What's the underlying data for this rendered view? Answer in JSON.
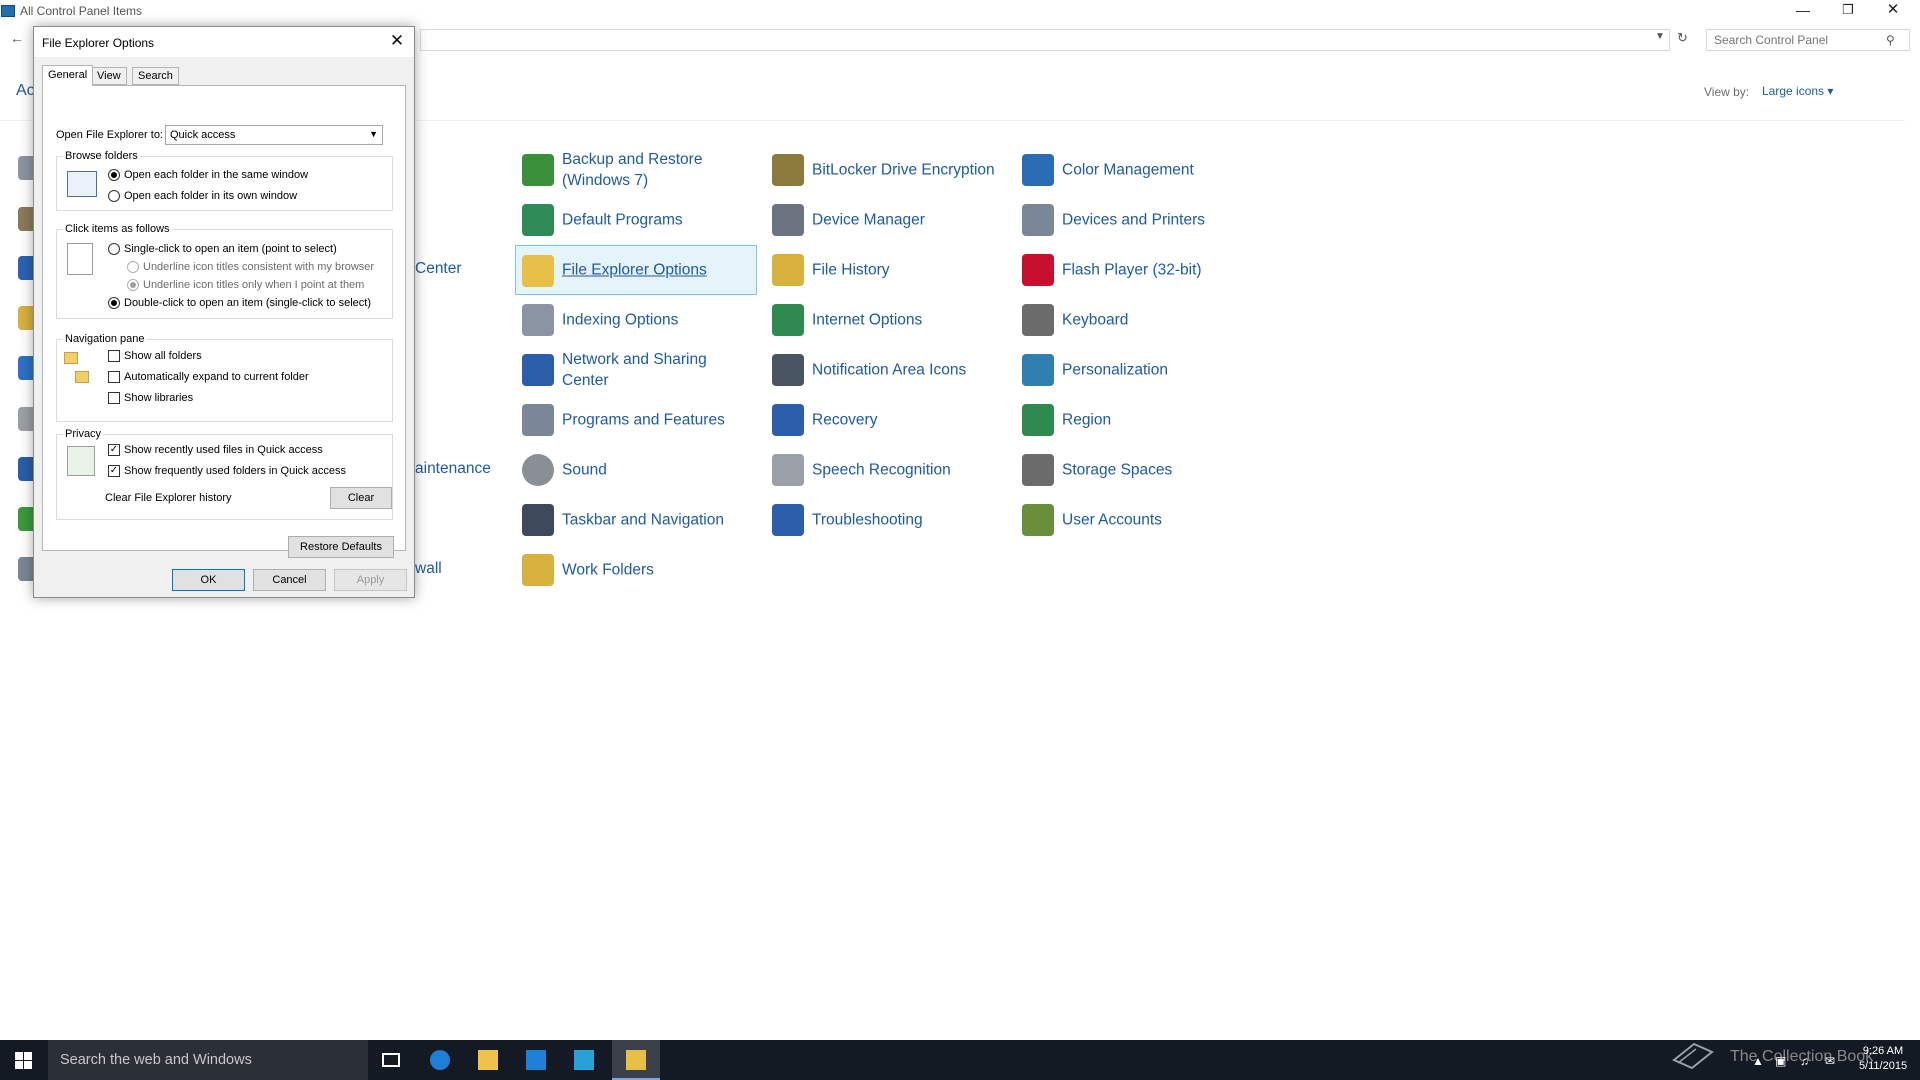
{
  "window": {
    "title": "All Control Panel Items",
    "search_placeholder": "Search Control Panel",
    "heading_fragment": "Ac",
    "view_by_label": "View by:",
    "view_by_value": "Large icons ▾"
  },
  "items": [
    {
      "label": "Backup and Restore (Windows 7)",
      "icon": "backup-restore-icon",
      "color": "#3a8f3a"
    },
    {
      "label": "BitLocker Drive Encryption",
      "icon": "bitlocker-icon",
      "color": "#8c7a3a"
    },
    {
      "label": "Color Management",
      "icon": "color-management-icon",
      "color": "#2b6db5"
    },
    {
      "label": "Default Programs",
      "icon": "default-programs-icon",
      "color": "#2e8b57"
    },
    {
      "label": "Device Manager",
      "icon": "device-manager-icon",
      "color": "#6b7280"
    },
    {
      "label": "Devices and Printers",
      "icon": "devices-printers-icon",
      "color": "#7a8796"
    },
    {
      "label": "File Explorer Options",
      "icon": "file-explorer-options-icon",
      "color": "#e6bf47",
      "selected": true
    },
    {
      "label": "File History",
      "icon": "file-history-icon",
      "color": "#d8b13e"
    },
    {
      "label": "Flash Player (32-bit)",
      "icon": "flash-player-icon",
      "color": "#c8102e"
    },
    {
      "label": "Indexing Options",
      "icon": "indexing-options-icon",
      "color": "#8a94a3"
    },
    {
      "label": "Internet Options",
      "icon": "internet-options-icon",
      "color": "#2f8a4f"
    },
    {
      "label": "Keyboard",
      "icon": "keyboard-icon",
      "color": "#6b6b6b"
    },
    {
      "label": "Network and Sharing Center",
      "icon": "network-sharing-icon",
      "color": "#2a5ea8"
    },
    {
      "label": "Notification Area Icons",
      "icon": "notification-area-icon",
      "color": "#4a5563"
    },
    {
      "label": "Personalization",
      "icon": "personalization-icon",
      "color": "#2f7fb0"
    },
    {
      "label": "Programs and Features",
      "icon": "programs-features-icon",
      "color": "#7a8796"
    },
    {
      "label": "Recovery",
      "icon": "recovery-icon",
      "color": "#2a5ea8"
    },
    {
      "label": "Region",
      "icon": "region-icon",
      "color": "#2f8a4f"
    },
    {
      "label": "Sound",
      "icon": "sound-icon",
      "color": "#8a8f96"
    },
    {
      "label": "Speech Recognition",
      "icon": "speech-recognition-icon",
      "color": "#9aa0a6"
    },
    {
      "label": "Storage Spaces",
      "icon": "storage-spaces-icon",
      "color": "#6b6b6b"
    },
    {
      "label": "Taskbar and Navigation",
      "icon": "taskbar-navigation-icon",
      "color": "#3c4a5c"
    },
    {
      "label": "Troubleshooting",
      "icon": "troubleshooting-icon",
      "color": "#2a5ea8"
    },
    {
      "label": "User Accounts",
      "icon": "user-accounts-icon",
      "color": "#6a8f3a"
    },
    {
      "label": "Work Folders",
      "icon": "work-folders-icon",
      "color": "#d8b13e"
    }
  ],
  "partial_labels": [
    "Center",
    "aintenance",
    "wall"
  ],
  "dialog": {
    "title": "File Explorer Options",
    "tabs": [
      "General",
      "View",
      "Search"
    ],
    "open_label": "Open File Explorer to:",
    "open_value": "Quick access",
    "browse": {
      "title": "Browse folders",
      "same_window": "Open each folder in the same window",
      "own_window": "Open each folder in its own window"
    },
    "click": {
      "title": "Click items as follows",
      "single": "Single-click to open an item (point to select)",
      "underline_browser": "Underline icon titles consistent with my browser",
      "underline_point": "Underline icon titles only when I point at them",
      "double": "Double-click to open an item (single-click to select)"
    },
    "nav": {
      "title": "Navigation pane",
      "show_all": "Show all folders",
      "auto_expand": "Automatically expand to current folder",
      "show_libraries": "Show libraries"
    },
    "privacy": {
      "title": "Privacy",
      "recent_files": "Show recently used files in Quick access",
      "frequent_folders": "Show frequently used folders in Quick access",
      "clear_label": "Clear File Explorer history",
      "clear_button": "Clear"
    },
    "restore_button": "Restore Defaults",
    "ok": "OK",
    "cancel": "Cancel",
    "apply": "Apply"
  },
  "taskbar": {
    "search_text": "Search the web and Windows",
    "tray_text": "The Collection Book",
    "time": "9:26 AM",
    "date": "5/11/2015"
  }
}
